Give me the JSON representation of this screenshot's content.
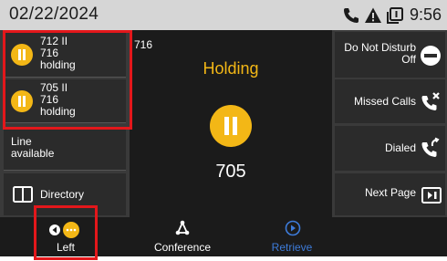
{
  "status_bar": {
    "date": "02/22/2024",
    "time": "9:56",
    "icons": [
      "phone-icon",
      "warning-icon",
      "copy-icon"
    ]
  },
  "line_keys": [
    {
      "title": "712 II",
      "number": "716",
      "state": "holding",
      "icon": "hold-icon"
    },
    {
      "title": "705 II",
      "number": "716",
      "state": "holding",
      "icon": "hold-icon"
    }
  ],
  "line_available": {
    "line1": "Line",
    "line2": "available"
  },
  "directory": {
    "label": "Directory",
    "icon": "book-icon"
  },
  "center": {
    "line_number": "716",
    "status": "Holding",
    "number": "705",
    "icon": "hold-icon"
  },
  "right_keys": [
    {
      "label_line1": "Do Not Disturb",
      "label_line2": "Off",
      "icon": "dnd-icon"
    },
    {
      "label": "Missed Calls",
      "icon": "missed-call-icon"
    },
    {
      "label": "Dialed",
      "icon": "dialed-call-icon"
    },
    {
      "label": "Next Page",
      "icon": "next-page-icon"
    }
  ],
  "softkeys": [
    {
      "label": "Left",
      "icon": "left-hold-icon"
    },
    {
      "label": "Conference",
      "icon": "conference-icon"
    },
    {
      "label": "Retrieve",
      "icon": "retrieve-icon"
    }
  ],
  "colors": {
    "accent_yellow": "#f3b716",
    "highlight_red": "#e3171b",
    "retrieve_blue": "#3d7bd9",
    "status_bar_bg": "#d6d6d6"
  }
}
